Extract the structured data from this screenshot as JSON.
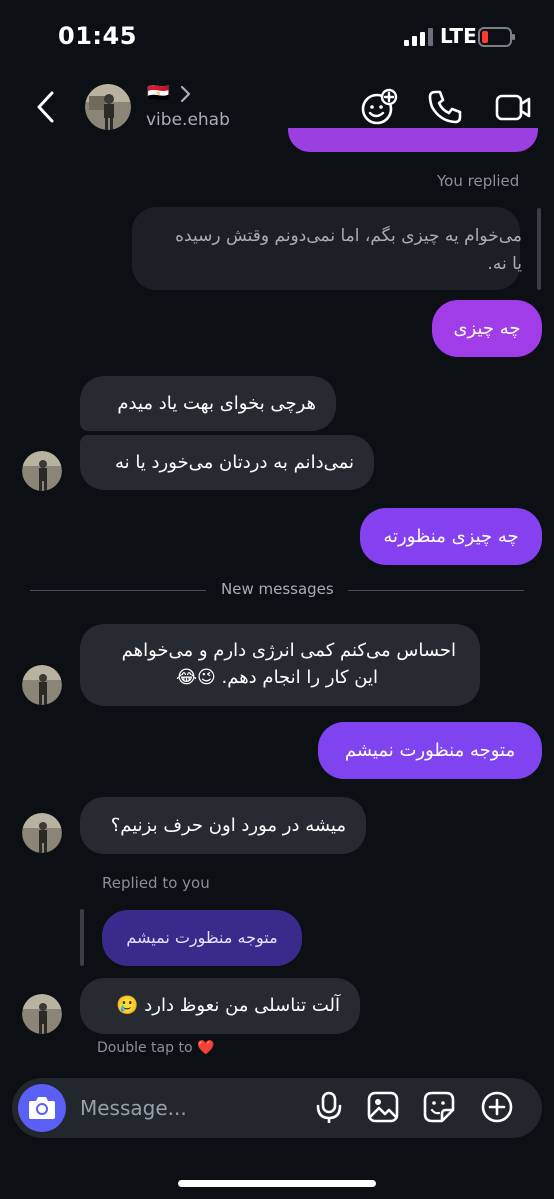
{
  "status_bar": {
    "time": "01:45",
    "network": "LTE"
  },
  "header": {
    "flag": "🇪🇬",
    "username": "vibe.ehab"
  },
  "thread": {
    "you_replied_label": "You replied",
    "quoted_reply": {
      "line1": "می‌خوام یه چیزی بگم، اما نمی‌دونم وقتش رسیده",
      "line2": "یا نه."
    },
    "msg_out_1": "چه چیزی",
    "msg_in_1": "هرچی بخوای بهت یاد میدم",
    "msg_in_2": "نمی‌دانم به دردتان می‌خورد یا نه",
    "msg_out_2": "چه چیزی منظورته",
    "new_messages_label": "New messages",
    "msg_in_3": {
      "line1": "احساس می‌کنم کمی انرژی دارم و می‌خواهم",
      "line2": "این کار را انجام دهم. 😉😂"
    },
    "msg_out_3": "متوجه منظورت نمیشم",
    "msg_in_4": "میشه در مورد اون حرف بزنیم؟",
    "replied_to_you_label": "Replied to you",
    "quoted_message": "متوجه منظورت نمیشم",
    "msg_in_5": "آلت تناسلی من نعوظ دارد 🥲",
    "double_tap_label": "Double tap to ❤️"
  },
  "composer": {
    "placeholder": "Message..."
  },
  "colors": {
    "accent_purple": "#a03ce8",
    "accent_violet": "#7f43f0",
    "camera_blue": "#5b5ff5",
    "bubble_in": "#262a31",
    "background": "#0c0f14"
  },
  "icons": [
    "back-icon",
    "chevron-right-icon",
    "effects-icon",
    "phone-icon",
    "video-icon",
    "camera-icon",
    "microphone-icon",
    "gallery-icon",
    "sticker-icon",
    "plus-icon"
  ]
}
